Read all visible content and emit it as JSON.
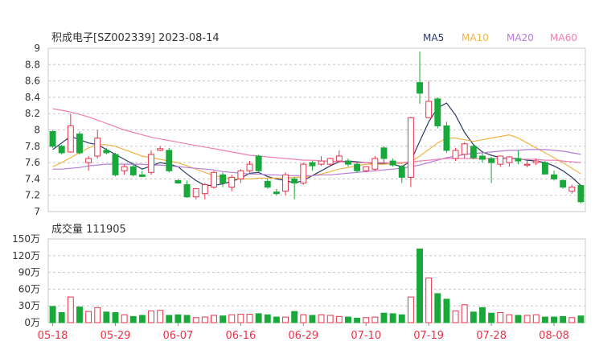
{
  "header": {
    "title": "积成电子[SZ002339] 2023-08-14",
    "legend": [
      {
        "label": "MA5",
        "color": "#2b3a67"
      },
      {
        "label": "MA10",
        "color": "#f0b445"
      },
      {
        "label": "MA20",
        "color": "#b57bd6"
      },
      {
        "label": "MA60",
        "color": "#f07fb2"
      }
    ]
  },
  "volume_header": {
    "label": "成交量",
    "value": "111905"
  },
  "colors": {
    "up": "#e8334a",
    "down": "#19a83a",
    "grid": "#c8c8c8"
  },
  "chart_data": [
    {
      "type": "candlestick",
      "title": "积成电子[SZ002339] 2023-08-14",
      "ylim": [
        7,
        9
      ],
      "y_ticks": [
        "9",
        "8.8",
        "8.6",
        "8.4",
        "8.2",
        "8",
        "7.8",
        "7.6",
        "7.4",
        "7.2",
        "7"
      ],
      "x_ticks": [
        "05-18",
        "05-29",
        "06-07",
        "06-16",
        "06-29",
        "07-10",
        "07-19",
        "07-28",
        "08-08"
      ],
      "x_tick_index": [
        0,
        7,
        14,
        21,
        28,
        35,
        42,
        49,
        56
      ],
      "ohlc": [
        [
          7.98,
          8.0,
          7.78,
          7.8
        ],
        [
          7.8,
          7.82,
          7.7,
          7.72
        ],
        [
          7.73,
          8.2,
          7.72,
          8.05
        ],
        [
          7.95,
          7.98,
          7.7,
          7.72
        ],
        [
          7.6,
          7.68,
          7.5,
          7.65
        ],
        [
          7.68,
          8.0,
          7.65,
          7.9
        ],
        [
          7.75,
          7.78,
          7.7,
          7.72
        ],
        [
          7.7,
          7.72,
          7.43,
          7.45
        ],
        [
          7.5,
          7.58,
          7.45,
          7.55
        ],
        [
          7.55,
          7.6,
          7.43,
          7.45
        ],
        [
          7.45,
          7.5,
          7.42,
          7.43
        ],
        [
          7.48,
          7.75,
          7.45,
          7.7
        ],
        [
          7.75,
          7.8,
          7.74,
          7.77
        ],
        [
          7.75,
          7.78,
          7.48,
          7.5
        ],
        [
          7.38,
          7.4,
          7.34,
          7.35
        ],
        [
          7.33,
          7.38,
          7.17,
          7.18
        ],
        [
          7.18,
          7.28,
          7.15,
          7.28
        ],
        [
          7.22,
          7.35,
          7.15,
          7.33
        ],
        [
          7.3,
          7.5,
          7.28,
          7.48
        ],
        [
          7.45,
          7.48,
          7.3,
          7.35
        ],
        [
          7.3,
          7.45,
          7.25,
          7.42
        ],
        [
          7.4,
          7.52,
          7.35,
          7.5
        ],
        [
          7.5,
          7.62,
          7.48,
          7.58
        ],
        [
          7.68,
          7.7,
          7.48,
          7.5
        ],
        [
          7.37,
          7.4,
          7.28,
          7.3
        ],
        [
          7.24,
          7.28,
          7.2,
          7.22
        ],
        [
          7.25,
          7.48,
          7.2,
          7.45
        ],
        [
          7.4,
          7.42,
          7.15,
          7.35
        ],
        [
          7.35,
          7.6,
          7.33,
          7.58
        ],
        [
          7.6,
          7.62,
          7.5,
          7.56
        ],
        [
          7.58,
          7.68,
          7.56,
          7.62
        ],
        [
          7.58,
          7.66,
          7.56,
          7.65
        ],
        [
          7.62,
          7.75,
          7.6,
          7.68
        ],
        [
          7.62,
          7.65,
          7.55,
          7.58
        ],
        [
          7.58,
          7.6,
          7.48,
          7.5
        ],
        [
          7.5,
          7.55,
          7.48,
          7.55
        ],
        [
          7.52,
          7.68,
          7.5,
          7.65
        ],
        [
          7.78,
          7.8,
          7.6,
          7.65
        ],
        [
          7.62,
          7.65,
          7.55,
          7.57
        ],
        [
          7.55,
          7.57,
          7.35,
          7.42
        ],
        [
          7.42,
          8.16,
          7.3,
          8.15
        ],
        [
          8.58,
          8.96,
          8.32,
          8.45
        ],
        [
          8.15,
          8.6,
          8.15,
          8.35
        ],
        [
          8.38,
          8.4,
          8.02,
          8.05
        ],
        [
          8.05,
          8.1,
          7.72,
          7.75
        ],
        [
          7.65,
          7.78,
          7.62,
          7.75
        ],
        [
          7.7,
          7.85,
          7.65,
          7.83
        ],
        [
          7.8,
          7.82,
          7.64,
          7.66
        ],
        [
          7.68,
          7.73,
          7.6,
          7.64
        ],
        [
          7.65,
          7.67,
          7.35,
          7.6
        ],
        [
          7.58,
          7.68,
          7.55,
          7.68
        ],
        [
          7.6,
          7.68,
          7.55,
          7.67
        ],
        [
          7.65,
          7.75,
          7.58,
          7.62
        ],
        [
          7.58,
          7.62,
          7.54,
          7.58
        ],
        [
          7.6,
          7.65,
          7.57,
          7.62
        ],
        [
          7.6,
          7.62,
          7.45,
          7.46
        ],
        [
          7.45,
          7.5,
          7.38,
          7.4
        ],
        [
          7.38,
          7.4,
          7.28,
          7.3
        ],
        [
          7.25,
          7.33,
          7.22,
          7.3
        ],
        [
          7.32,
          7.33,
          7.1,
          7.12
        ]
      ],
      "ma": {
        "MA5": [
          7.76,
          7.84,
          7.92,
          7.88,
          7.84,
          7.82,
          7.76,
          7.7,
          7.64,
          7.58,
          7.52,
          7.56,
          7.6,
          7.58,
          7.55,
          7.46,
          7.38,
          7.32,
          7.32,
          7.34,
          7.37,
          7.41,
          7.47,
          7.48,
          7.43,
          7.4,
          7.38,
          7.35,
          7.38,
          7.44,
          7.5,
          7.56,
          7.61,
          7.62,
          7.61,
          7.6,
          7.59,
          7.59,
          7.58,
          7.55,
          7.62,
          7.86,
          8.1,
          8.27,
          8.33,
          8.18,
          7.97,
          7.82,
          7.73,
          7.69,
          7.66,
          7.65,
          7.65,
          7.63,
          7.62,
          7.6,
          7.56,
          7.5,
          7.42,
          7.32
        ],
        "MA10": [
          7.55,
          7.6,
          7.66,
          7.72,
          7.78,
          7.82,
          7.82,
          7.8,
          7.76,
          7.72,
          7.68,
          7.66,
          7.64,
          7.62,
          7.6,
          7.56,
          7.52,
          7.48,
          7.44,
          7.42,
          7.4,
          7.4,
          7.4,
          7.41,
          7.41,
          7.41,
          7.41,
          7.42,
          7.42,
          7.44,
          7.46,
          7.49,
          7.52,
          7.54,
          7.56,
          7.58,
          7.58,
          7.58,
          7.59,
          7.59,
          7.61,
          7.68,
          7.76,
          7.84,
          7.9,
          7.9,
          7.88,
          7.86,
          7.88,
          7.9,
          7.92,
          7.94,
          7.9,
          7.84,
          7.78,
          7.72,
          7.66,
          7.6,
          7.53,
          7.46
        ],
        "MA20": [
          7.52,
          7.52,
          7.53,
          7.54,
          7.56,
          7.57,
          7.58,
          7.58,
          7.58,
          7.58,
          7.58,
          7.57,
          7.57,
          7.56,
          7.55,
          7.54,
          7.53,
          7.52,
          7.51,
          7.49,
          7.48,
          7.47,
          7.46,
          7.46,
          7.45,
          7.45,
          7.44,
          7.44,
          7.44,
          7.44,
          7.45,
          7.45,
          7.46,
          7.47,
          7.48,
          7.49,
          7.5,
          7.51,
          7.52,
          7.53,
          7.55,
          7.57,
          7.6,
          7.63,
          7.66,
          7.68,
          7.7,
          7.71,
          7.72,
          7.73,
          7.74,
          7.75,
          7.75,
          7.76,
          7.76,
          7.76,
          7.75,
          7.74,
          7.72,
          7.7
        ],
        "MA60": [
          8.26,
          8.24,
          8.22,
          8.19,
          8.16,
          8.12,
          8.08,
          8.04,
          8.0,
          7.97,
          7.94,
          7.91,
          7.89,
          7.87,
          7.85,
          7.83,
          7.81,
          7.79,
          7.77,
          7.75,
          7.73,
          7.71,
          7.69,
          7.68,
          7.67,
          7.66,
          7.65,
          7.64,
          7.63,
          7.63,
          7.62,
          7.62,
          7.61,
          7.61,
          7.6,
          7.6,
          7.6,
          7.6,
          7.6,
          7.6,
          7.61,
          7.62,
          7.63,
          7.64,
          7.65,
          7.65,
          7.65,
          7.65,
          7.65,
          7.65,
          7.65,
          7.65,
          7.64,
          7.64,
          7.64,
          7.63,
          7.63,
          7.62,
          7.61,
          7.6
        ]
      }
    },
    {
      "type": "bar",
      "title": "成交量 111905",
      "ylim": [
        0,
        150
      ],
      "y_ticks": [
        "150万",
        "120万",
        "90万",
        "60万",
        "30万",
        "0万"
      ],
      "x_ticks": [
        "05-18",
        "05-29",
        "06-07",
        "06-16",
        "06-29",
        "07-10",
        "07-19",
        "07-28",
        "08-08"
      ],
      "values": [
        29,
        18,
        46,
        28,
        20,
        27,
        19,
        18,
        14,
        11,
        13,
        21,
        22,
        13,
        14,
        13,
        9,
        10,
        13,
        12,
        14,
        15,
        15,
        16,
        14,
        10,
        10,
        20,
        14,
        13,
        14,
        13,
        11,
        10,
        8,
        9,
        10,
        17,
        16,
        14,
        46,
        132,
        80,
        52,
        42,
        21,
        32,
        19,
        27,
        17,
        18,
        14,
        13,
        13,
        14,
        10,
        10,
        11,
        9,
        12
      ]
    }
  ]
}
